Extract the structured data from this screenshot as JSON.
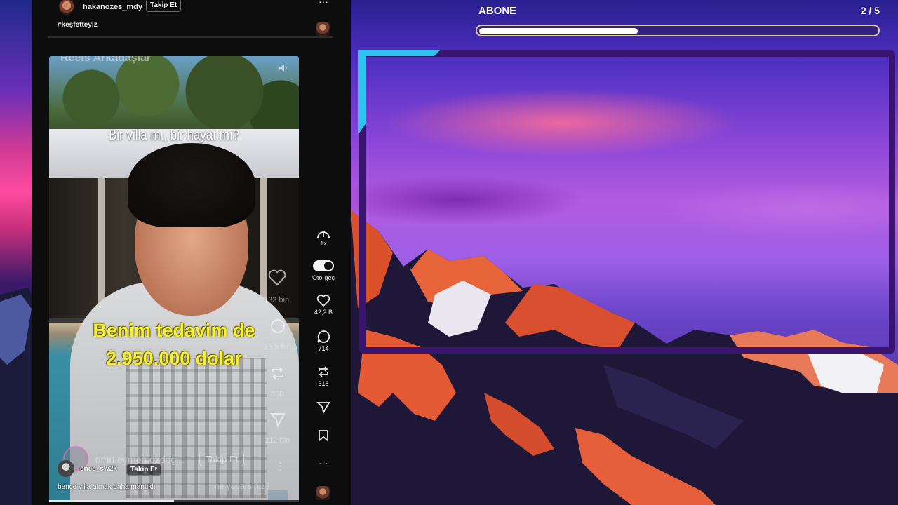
{
  "top_post": {
    "username": "hakanozes_mdy",
    "follow_label": "Takip Et",
    "hashtag": "#keşfetteyiz",
    "more_label": "···"
  },
  "video": {
    "tabs_ghost": "Reels      Arkadaşlar",
    "caption_top": "Bir villa mı, bir hayat mı?",
    "caption_line1": "Benim tedavim de",
    "caption_line2": "2.950.000 dolar",
    "ghost_stats": [
      "133 bin",
      "15,5 bin",
      "850",
      "112 bin"
    ],
    "ghost_username": "dmd.eymen.ozdog...",
    "ghost_follow": "Takip Et",
    "ghost_caption": "ne yaparsınız?",
    "comment_user": "enes_sw2k",
    "comment_follow": "Takip Et",
    "comment_text": "bence villa almak daha mantıklı",
    "progress_fraction": 0.5
  },
  "rail": {
    "speed_label": "1x",
    "autoplay_label": "Oto-geç",
    "autoplay_on": true,
    "likes": "42,2 B",
    "comments": "714",
    "reposts": "518",
    "more_label": "···"
  },
  "header": {
    "title": "ABONE",
    "counter": "2 / 5",
    "progress_fraction": 0.4
  },
  "colors": {
    "accent_cyan": "#27c6ee",
    "frame_purple": "#3a1570",
    "caption_yellow": "#f5ee3a"
  },
  "icons": [
    "speed-icon",
    "toggle-icon",
    "heart-icon",
    "comment-icon",
    "repost-icon",
    "send-icon",
    "bookmark-icon",
    "more-icon",
    "volume-icon"
  ]
}
